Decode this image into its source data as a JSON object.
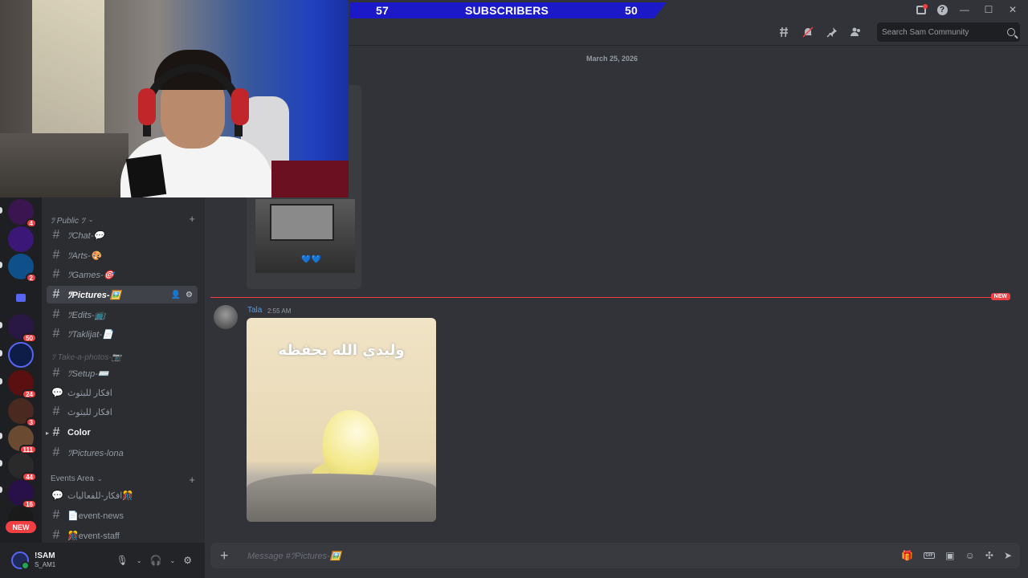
{
  "overlay": {
    "subscribers_left": "57",
    "subscribers_label": "SUBSCRIBERS",
    "subscribers_right": "50"
  },
  "header": {
    "search_placeholder": "Search Sam Community",
    "icons": [
      "threads-icon",
      "mute-icon",
      "pin-icon",
      "members-icon"
    ]
  },
  "servers": [
    {
      "badge": "4",
      "color": "#3a1550"
    },
    {
      "badge": "",
      "color": "#3b1878"
    },
    {
      "badge": "2",
      "color": "#10508a"
    },
    {
      "badge": "50",
      "color": "#2a1844"
    },
    {
      "badge": "",
      "color": "#0e1c48"
    },
    {
      "badge": "24",
      "color": "#5a1010"
    },
    {
      "badge": "3",
      "color": "#4a2a20"
    },
    {
      "badge": "111",
      "color": "#6a4a30"
    },
    {
      "badge": "44",
      "color": "#2a2a2a"
    },
    {
      "badge": "16",
      "color": "#281048"
    },
    {
      "badge": "",
      "color": "#1a1a1a"
    }
  ],
  "new_badge": "NEW",
  "sidebar": {
    "categories": [
      {
        "label": "ﾂ Public ﾂ"
      },
      {
        "label": "Events Area"
      }
    ],
    "channels": [
      {
        "name": "ﾂChat-💬",
        "type": "text"
      },
      {
        "name": "ﾂArts-🎨",
        "type": "text"
      },
      {
        "name": "ﾂGames-🎯",
        "type": "text"
      },
      {
        "name": "ﾂPictures-🖼️",
        "type": "text"
      },
      {
        "name": "ﾂEdits-📺",
        "type": "text"
      },
      {
        "name": "ﾂTaklijat-📄",
        "type": "text"
      },
      {
        "name": "ﾂSetup-⌨️",
        "type": "text"
      },
      {
        "name": "افكار للبثوث",
        "type": "forum"
      },
      {
        "name": "افكار للبثوث",
        "type": "text"
      },
      {
        "name": "Color",
        "type": "text"
      },
      {
        "name": "ﾂPictures-lona",
        "type": "text"
      },
      {
        "name": "افكار-للفعاليات🎊",
        "type": "forum"
      },
      {
        "name": "📄event-news",
        "type": "text"
      },
      {
        "name": "🎊event-staff",
        "type": "text"
      }
    ],
    "drag_ghost": "ﾂ Take-a-photos-📷"
  },
  "user": {
    "display_name": "!SAM",
    "status": "S_AM1"
  },
  "chat": {
    "date": "March 25, 2026",
    "new_label": "NEW",
    "message": {
      "author": "Tala",
      "time": "2:55 AM",
      "image_caption": "وليدي الله يحفظه"
    },
    "top_image_emoji": "💙💙",
    "composer_placeholder": "Message #ﾂPictures-🖼️"
  }
}
